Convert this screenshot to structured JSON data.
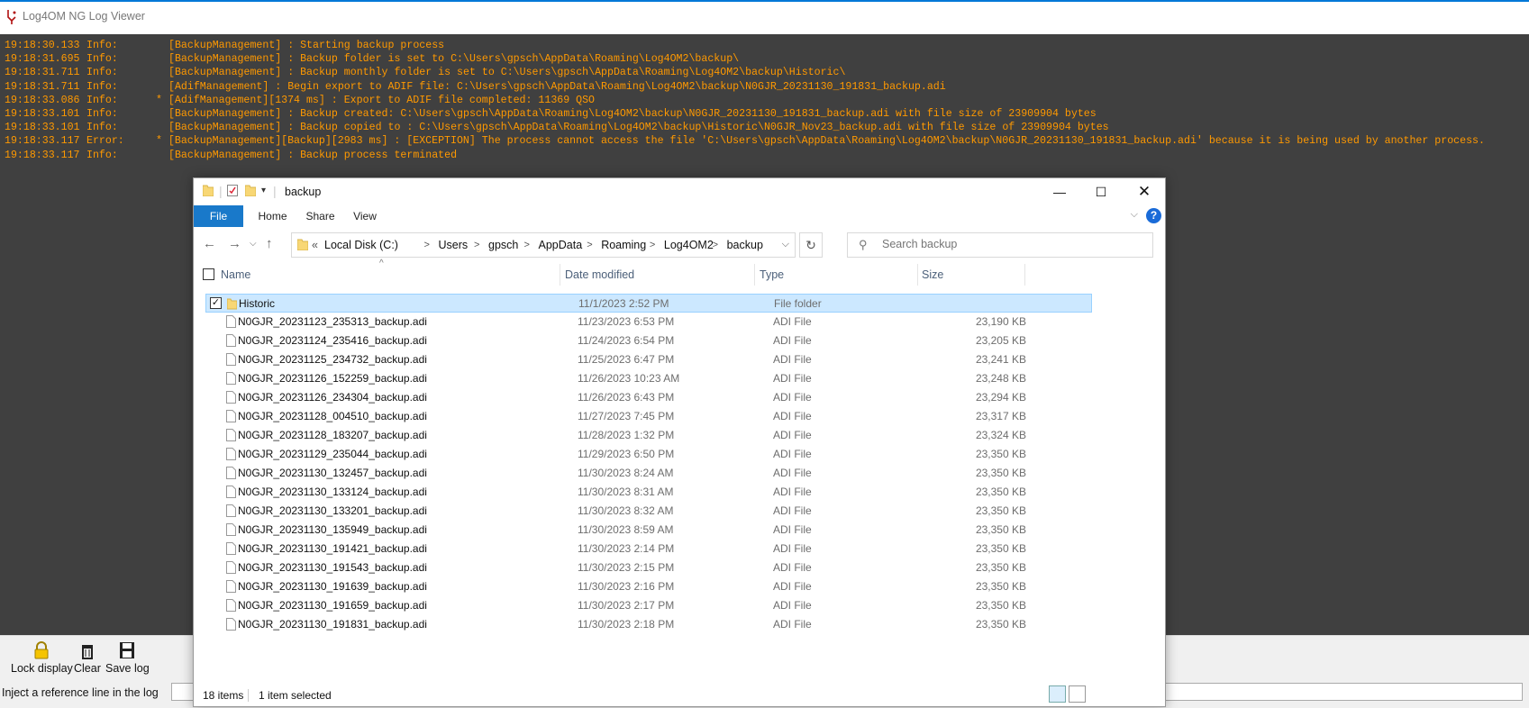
{
  "app": {
    "title": "Log4OM NG Log Viewer"
  },
  "log": [
    {
      "time": "19:18:30.133",
      "level": "Info:",
      "msg": "[BackupManagement] : Starting backup process"
    },
    {
      "time": "19:18:31.695",
      "level": "Info:",
      "msg": "[BackupManagement] : Backup folder is set to C:\\Users\\gpsch\\AppData\\Roaming\\Log4OM2\\backup\\"
    },
    {
      "time": "19:18:31.711",
      "level": "Info:",
      "msg": "[BackupManagement] : Backup monthly folder is set to C:\\Users\\gpsch\\AppData\\Roaming\\Log4OM2\\backup\\Historic\\"
    },
    {
      "time": "19:18:31.711",
      "level": "Info:",
      "msg": "[AdifManagement] : Begin export to ADIF file: C:\\Users\\gpsch\\AppData\\Roaming\\Log4OM2\\backup\\N0GJR_20231130_191831_backup.adi"
    },
    {
      "time": "19:18:33.086",
      "level": "Info:",
      "msg": "* [AdifManagement][1374 ms] : Export to ADIF file completed: 11369 QSO"
    },
    {
      "time": "19:18:33.101",
      "level": "Info:",
      "msg": "[BackupManagement] : Backup created: C:\\Users\\gpsch\\AppData\\Roaming\\Log4OM2\\backup\\N0GJR_20231130_191831_backup.adi with file size of 23909904 bytes"
    },
    {
      "time": "19:18:33.101",
      "level": "Info:",
      "msg": "[BackupManagement] : Backup copied to : C:\\Users\\gpsch\\AppData\\Roaming\\Log4OM2\\backup\\Historic\\N0GJR_Nov23_backup.adi with file size of 23909904 bytes"
    },
    {
      "time": "19:18:33.117",
      "level": "Error:",
      "msg": "* [BackupManagement][Backup][2983 ms] : [EXCEPTION] The process cannot access the file 'C:\\Users\\gpsch\\AppData\\Roaming\\Log4OM2\\backup\\N0GJR_20231130_191831_backup.adi' because it is being used by another process."
    },
    {
      "time": "19:18:33.117",
      "level": "Info:",
      "msg": "[BackupManagement] : Backup process terminated"
    }
  ],
  "toolbar": {
    "lock_label": "Lock display",
    "clear_label": "Clear",
    "save_label": "Save log",
    "inject_label": "Inject a reference line in the log",
    "inject_value": ""
  },
  "explorer": {
    "title": "backup",
    "ribbon": [
      "File",
      "Home",
      "Share",
      "View"
    ],
    "breadcrumb": [
      "Local Disk (C:)",
      "Users",
      "gpsch",
      "AppData",
      "Roaming",
      "Log4OM2",
      "backup"
    ],
    "breadcrumb_prefix": "«",
    "search_placeholder": "Search backup",
    "columns": {
      "name": "Name",
      "date": "Date modified",
      "type": "Type",
      "size": "Size"
    },
    "rows": [
      {
        "name": "Historic",
        "date": "11/1/2023 2:52 PM",
        "type": "File folder",
        "size": "",
        "folder": true,
        "selected": true
      },
      {
        "name": "N0GJR_20231123_235313_backup.adi",
        "date": "11/23/2023 6:53 PM",
        "type": "ADI File",
        "size": "23,190 KB"
      },
      {
        "name": "N0GJR_20231124_235416_backup.adi",
        "date": "11/24/2023 6:54 PM",
        "type": "ADI File",
        "size": "23,205 KB"
      },
      {
        "name": "N0GJR_20231125_234732_backup.adi",
        "date": "11/25/2023 6:47 PM",
        "type": "ADI File",
        "size": "23,241 KB"
      },
      {
        "name": "N0GJR_20231126_152259_backup.adi",
        "date": "11/26/2023 10:23 AM",
        "type": "ADI File",
        "size": "23,248 KB"
      },
      {
        "name": "N0GJR_20231126_234304_backup.adi",
        "date": "11/26/2023 6:43 PM",
        "type": "ADI File",
        "size": "23,294 KB"
      },
      {
        "name": "N0GJR_20231128_004510_backup.adi",
        "date": "11/27/2023 7:45 PM",
        "type": "ADI File",
        "size": "23,317 KB"
      },
      {
        "name": "N0GJR_20231128_183207_backup.adi",
        "date": "11/28/2023 1:32 PM",
        "type": "ADI File",
        "size": "23,324 KB"
      },
      {
        "name": "N0GJR_20231129_235044_backup.adi",
        "date": "11/29/2023 6:50 PM",
        "type": "ADI File",
        "size": "23,350 KB"
      },
      {
        "name": "N0GJR_20231130_132457_backup.adi",
        "date": "11/30/2023 8:24 AM",
        "type": "ADI File",
        "size": "23,350 KB"
      },
      {
        "name": "N0GJR_20231130_133124_backup.adi",
        "date": "11/30/2023 8:31 AM",
        "type": "ADI File",
        "size": "23,350 KB"
      },
      {
        "name": "N0GJR_20231130_133201_backup.adi",
        "date": "11/30/2023 8:32 AM",
        "type": "ADI File",
        "size": "23,350 KB"
      },
      {
        "name": "N0GJR_20231130_135949_backup.adi",
        "date": "11/30/2023 8:59 AM",
        "type": "ADI File",
        "size": "23,350 KB"
      },
      {
        "name": "N0GJR_20231130_191421_backup.adi",
        "date": "11/30/2023 2:14 PM",
        "type": "ADI File",
        "size": "23,350 KB"
      },
      {
        "name": "N0GJR_20231130_191543_backup.adi",
        "date": "11/30/2023 2:15 PM",
        "type": "ADI File",
        "size": "23,350 KB"
      },
      {
        "name": "N0GJR_20231130_191639_backup.adi",
        "date": "11/30/2023 2:16 PM",
        "type": "ADI File",
        "size": "23,350 KB"
      },
      {
        "name": "N0GJR_20231130_191659_backup.adi",
        "date": "11/30/2023 2:17 PM",
        "type": "ADI File",
        "size": "23,350 KB"
      },
      {
        "name": "N0GJR_20231130_191831_backup.adi",
        "date": "11/30/2023 2:18 PM",
        "type": "ADI File",
        "size": "23,350 KB"
      }
    ],
    "status": {
      "count": "18 items",
      "selection": "1 item selected"
    }
  },
  "colors": {
    "log_bg": "#404040",
    "log_text": "#ff9900",
    "selection": "#cce8ff",
    "accent": "#1979ca"
  }
}
